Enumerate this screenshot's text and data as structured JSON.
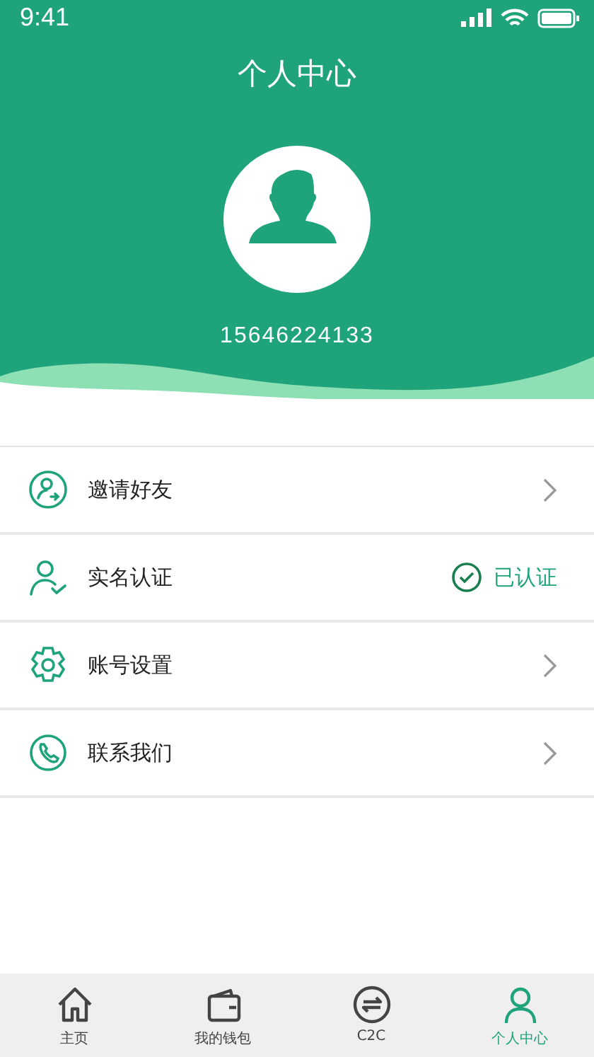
{
  "status_bar": {
    "time": "9:41"
  },
  "header": {
    "title": "个人中心",
    "phone": "15646224133"
  },
  "menu": [
    {
      "kind": "link",
      "label": "邀请好友"
    },
    {
      "kind": "status",
      "label": "实名认证",
      "status": "已认证"
    },
    {
      "kind": "link",
      "label": "账号设置"
    },
    {
      "kind": "link",
      "label": "联系我们"
    }
  ],
  "tabs": [
    {
      "label": "主页",
      "selected": false
    },
    {
      "label": "我的钱包",
      "selected": false
    },
    {
      "label": "C2C",
      "selected": false
    },
    {
      "label": "个人中心",
      "selected": true
    }
  ]
}
